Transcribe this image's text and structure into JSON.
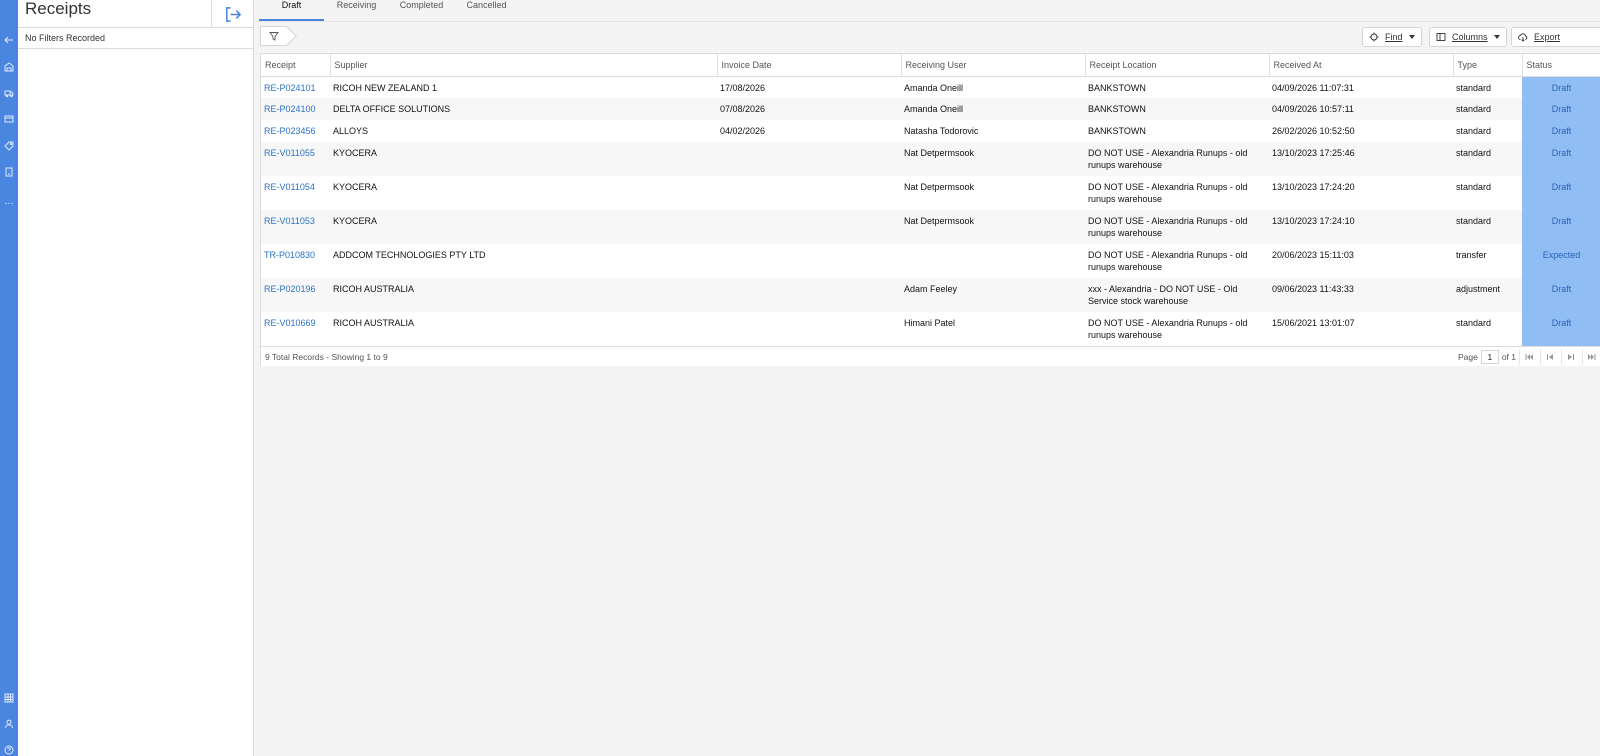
{
  "rail": {
    "top_icons": [
      "back-arrow-icon",
      "warehouse-icon",
      "truck-icon",
      "card-icon",
      "tag-icon",
      "building-icon"
    ],
    "more": "…",
    "bottom_icons": [
      "grid-icon",
      "user-icon",
      "help-icon"
    ]
  },
  "sidebar": {
    "title": "Receipts",
    "filters_text": "No Filters Recorded"
  },
  "tabs": [
    {
      "label": "Draft",
      "active": true
    },
    {
      "label": "Receiving",
      "active": false
    },
    {
      "label": "Completed",
      "active": false
    },
    {
      "label": "Cancelled",
      "active": false
    }
  ],
  "toolbar": {
    "find_label": "Find",
    "columns_label": "Columns",
    "export_label": "Export"
  },
  "grid": {
    "columns": [
      "Receipt",
      "Supplier",
      "Invoice Date",
      "Receiving User",
      "Receipt Location",
      "Received At",
      "Type",
      "Status"
    ],
    "rows": [
      {
        "receipt": "RE-P024101",
        "supplier": "RICOH NEW ZEALAND 1",
        "invoice_date": "17/08/2026",
        "user": "Amanda Oneill",
        "location": "BANKSTOWN",
        "received_at": "04/09/2026 11:07:31",
        "type": "standard",
        "status": "Draft"
      },
      {
        "receipt": "RE-P024100",
        "supplier": "DELTA OFFICE SOLUTIONS",
        "invoice_date": "07/08/2026",
        "user": "Amanda Oneill",
        "location": "BANKSTOWN",
        "received_at": "04/09/2026 10:57:11",
        "type": "standard",
        "status": "Draft"
      },
      {
        "receipt": "RE-P023456",
        "supplier": "ALLOYS",
        "invoice_date": "04/02/2026",
        "user": "Natasha Todorovic",
        "location": "BANKSTOWN",
        "received_at": "26/02/2026 10:52:50",
        "type": "standard",
        "status": "Draft"
      },
      {
        "receipt": "RE-V011055",
        "supplier": "KYOCERA",
        "invoice_date": "",
        "user": "Nat Detpermsook",
        "location": "DO NOT USE - Alexandria Runups - old runups warehouse",
        "received_at": "13/10/2023 17:25:46",
        "type": "standard",
        "status": "Draft"
      },
      {
        "receipt": "RE-V011054",
        "supplier": "KYOCERA",
        "invoice_date": "",
        "user": "Nat Detpermsook",
        "location": "DO NOT USE - Alexandria Runups - old runups warehouse",
        "received_at": "13/10/2023 17:24:20",
        "type": "standard",
        "status": "Draft"
      },
      {
        "receipt": "RE-V011053",
        "supplier": "KYOCERA",
        "invoice_date": "",
        "user": "Nat Detpermsook",
        "location": "DO NOT USE - Alexandria Runups - old runups warehouse",
        "received_at": "13/10/2023 17:24:10",
        "type": "standard",
        "status": "Draft"
      },
      {
        "receipt": "TR-P010830",
        "supplier": "ADDCOM TECHNOLOGIES PTY LTD",
        "invoice_date": "",
        "user": "",
        "location": "DO NOT USE - Alexandria Runups - old runups warehouse",
        "received_at": "20/06/2023 15:11:03",
        "type": "transfer",
        "status": "Expected"
      },
      {
        "receipt": "RE-P020196",
        "supplier": "RICOH AUSTRALIA",
        "invoice_date": "",
        "user": "Adam Feeley",
        "location": "xxx - Alexandria - DO NOT USE - Old Service stock warehouse",
        "received_at": "09/06/2023 11:43:33",
        "type": "adjustment",
        "status": "Draft"
      },
      {
        "receipt": "RE-V010669",
        "supplier": "RICOH AUSTRALIA",
        "invoice_date": "",
        "user": "Himani Patel",
        "location": "DO NOT USE - Alexandria Runups - old runups warehouse",
        "received_at": "15/06/2021 13:01:07",
        "type": "standard",
        "status": "Draft"
      }
    ]
  },
  "footer": {
    "records_text": "9 Total Records - Showing 1 to 9",
    "page_label": "Page",
    "page_value": "1",
    "of_label": "of 1"
  },
  "colors": {
    "accent": "#4a86e0",
    "link": "#2a72c9",
    "status_bg": "#90bdf4"
  }
}
